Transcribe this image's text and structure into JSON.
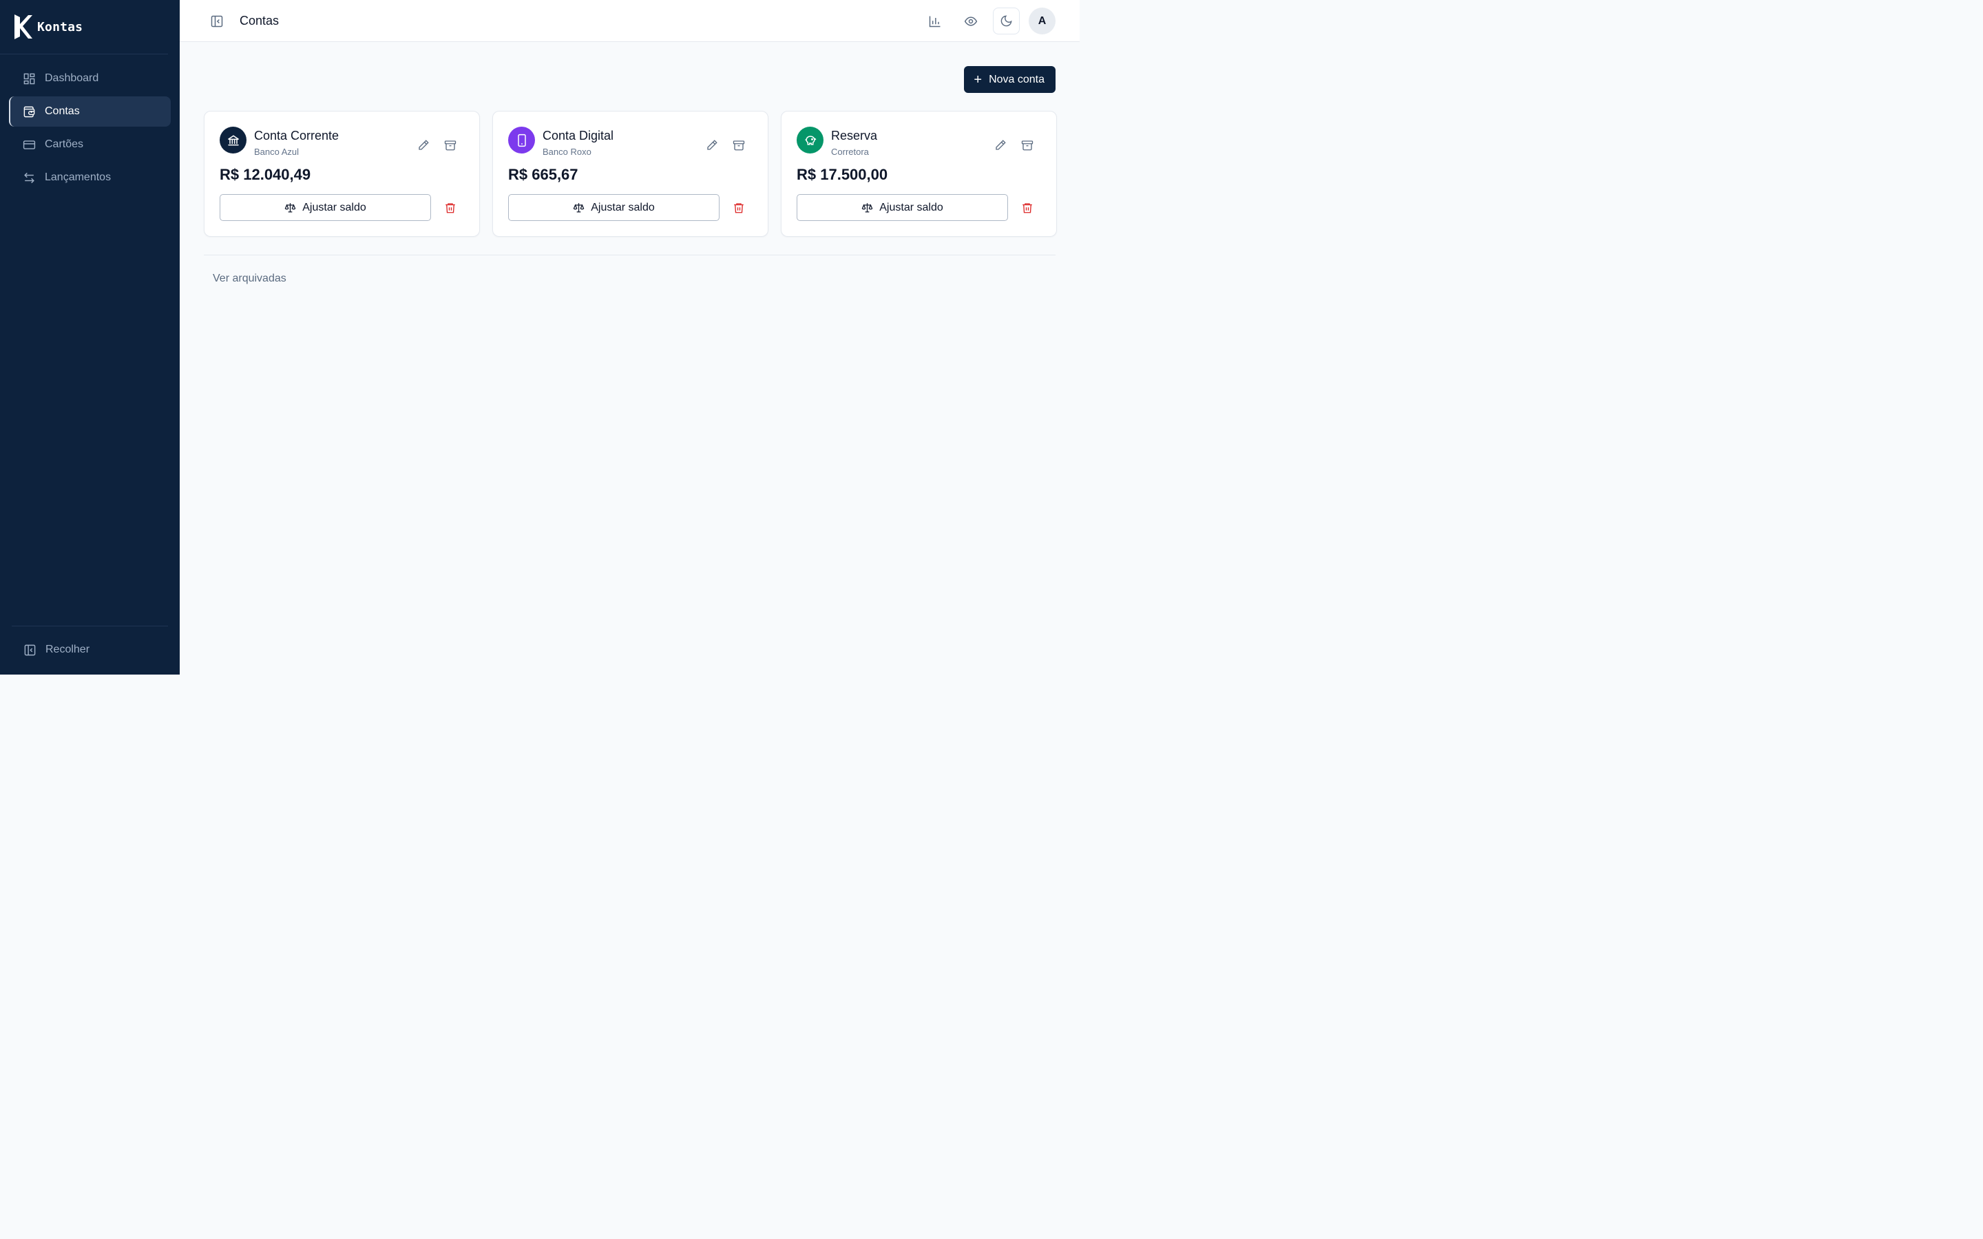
{
  "brand": {
    "name": "Kontas"
  },
  "sidebar": {
    "items": [
      {
        "label": "Dashboard",
        "icon": "dashboard-icon",
        "active": false
      },
      {
        "label": "Contas",
        "icon": "wallet-icon",
        "active": true
      },
      {
        "label": "Cartões",
        "icon": "credit-card-icon",
        "active": false
      },
      {
        "label": "Lançamentos",
        "icon": "arrows-left-right-icon",
        "active": false
      }
    ],
    "collapse_label": "Recolher"
  },
  "header": {
    "title": "Contas",
    "avatar_initial": "A"
  },
  "main": {
    "new_account_label": "Nova conta",
    "archived_link": "Ver arquivadas",
    "accounts": [
      {
        "name": "Conta Corrente",
        "bank": "Banco Azul",
        "balance": "R$ 12.040,49",
        "icon": "bank-icon",
        "color": "#0d223d"
      },
      {
        "name": "Conta Digital",
        "bank": "Banco Roxo",
        "balance": "R$ 665,67",
        "icon": "smartphone-icon",
        "color": "#7c3aed"
      },
      {
        "name": "Reserva",
        "bank": "Corretora",
        "balance": "R$ 17.500,00",
        "icon": "piggy-bank-icon",
        "color": "#059669"
      }
    ],
    "adjust_label": "Ajustar saldo"
  },
  "colors": {
    "sidebar_bg": "#0d223d",
    "accent": "#0d223d",
    "danger": "#dc2626"
  }
}
